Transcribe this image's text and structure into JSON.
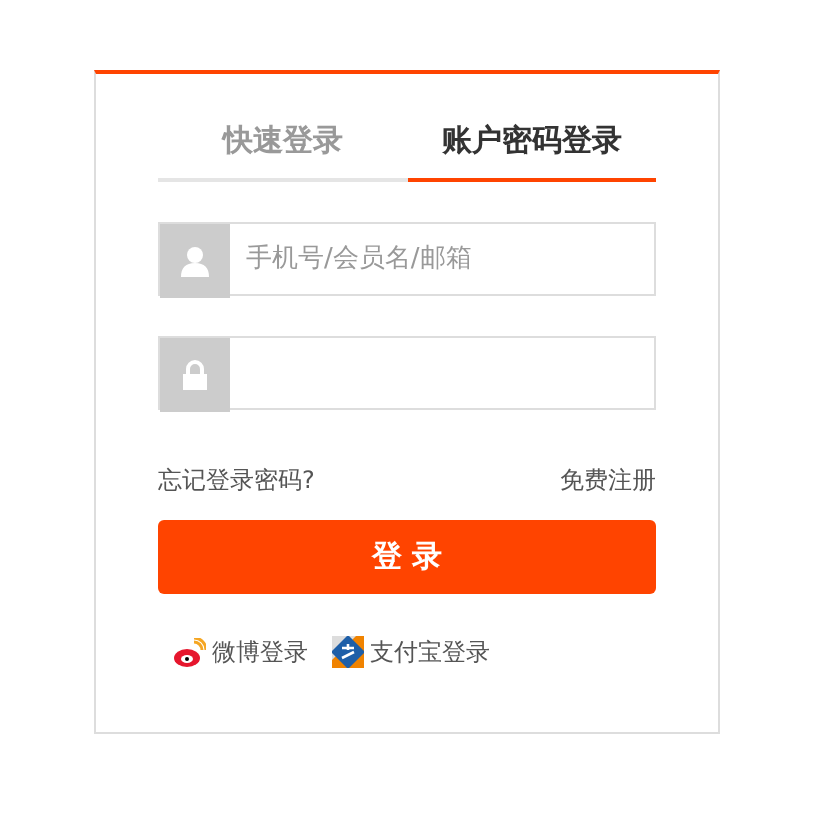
{
  "tabs": [
    {
      "label": "快速登录",
      "selected": false
    },
    {
      "label": "账户密码登录",
      "selected": true
    }
  ],
  "fields": [
    {
      "kind": "user",
      "placeholder": "手机号/会员名/邮箱"
    },
    {
      "kind": "password"
    }
  ],
  "forgot_link": "忘记登录密码?",
  "register_link": "免费注册",
  "login_button": "登 录",
  "social": [
    {
      "kind": "weibo",
      "label": "微博登录"
    },
    {
      "kind": "alipay",
      "label": "支付宝登录"
    }
  ]
}
